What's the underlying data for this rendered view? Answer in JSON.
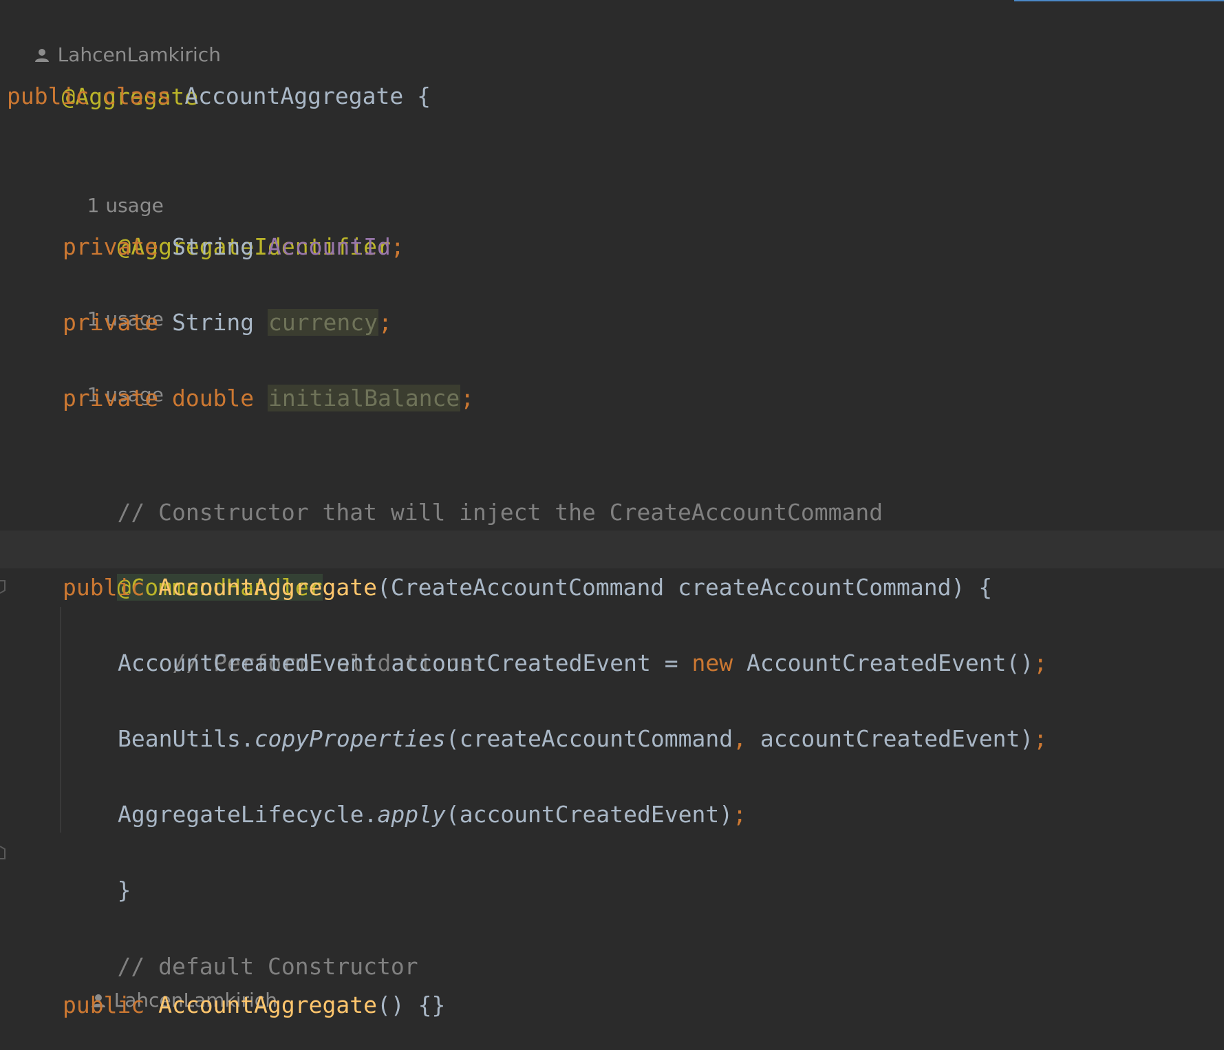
{
  "author": "LahcenLamkirich",
  "usage_hint": "1 usage",
  "lines": {
    "annotation_aggregate": "@Aggregate",
    "class_decl": {
      "kw1": "public",
      "kw2": "class",
      "name": "AccountAggregate",
      "brace": "{"
    },
    "aggregate_identifier": "@AggregateIdentifier",
    "field_account_id": {
      "kw": "private",
      "type": "String",
      "name": "AccountId",
      "semi": ";"
    },
    "field_currency": {
      "kw": "private",
      "type": "String",
      "name": "currency",
      "semi": ";"
    },
    "field_balance": {
      "kw": "private",
      "type": "double",
      "name": "initialBalance",
      "semi": ";"
    },
    "comment_constructor": "// Constructor that will inject the CreateAccountCommand",
    "command_handler": "@CommandHandler",
    "ctor_decl": {
      "kw": "public",
      "name": "AccountAggregate",
      "open": "(",
      "param_type": "CreateAccountCommand",
      "param_name": "createAccountCommand",
      "close": ") {"
    },
    "comment_validations": "// Perform validations:",
    "event_decl": {
      "type": "AccountCreatedEvent",
      "name": "accountCreatedEvent",
      "eq": "=",
      "new_kw": "new",
      "ctor": "AccountCreatedEvent()",
      "semi": ";"
    },
    "bean_utils": {
      "cls": "BeanUtils.",
      "method": "copyProperties",
      "open": "(createAccountCommand",
      "comma": ",",
      "rest": " accountCreatedEvent)",
      "semi": ";"
    },
    "apply": {
      "cls": "AggregateLifecycle.",
      "method": "apply",
      "args": "(accountCreatedEvent)",
      "semi": ";"
    },
    "close_brace": "}",
    "comment_default": "// default Constructor",
    "default_ctor": {
      "kw": "public",
      "name": "AccountAggregate",
      "rest": "() {}"
    }
  },
  "colors": {
    "background": "#2b2b2b",
    "keyword": "#cc7832",
    "annotation": "#bbb529",
    "field": "#9876aa",
    "method": "#ffc66d",
    "comment": "#808080",
    "text": "#a9b7c6"
  }
}
